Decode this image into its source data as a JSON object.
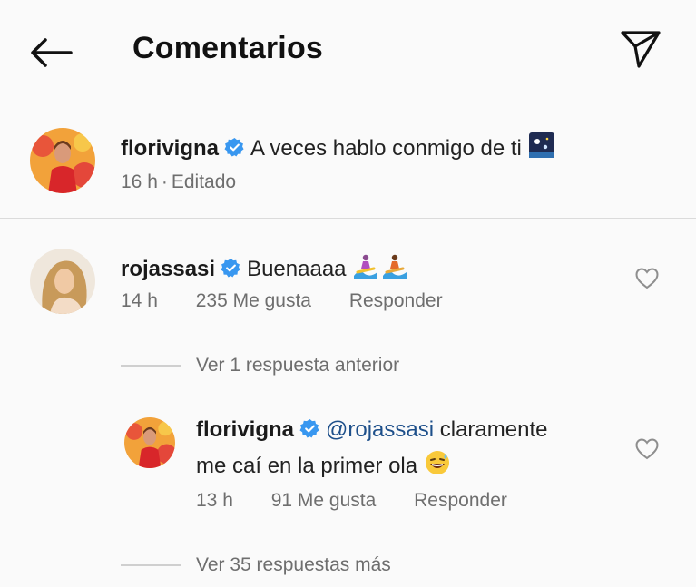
{
  "header": {
    "title": "Comentarios"
  },
  "caption": {
    "username": "florivigna",
    "text": "A veces hablo conmigo de ti",
    "time": "16 h",
    "edited": "Editado"
  },
  "comments": [
    {
      "username": "rojassasi",
      "text": "Buenaaaa",
      "time": "14 h",
      "likes": "235 Me gusta",
      "reply_label": "Responder",
      "view_replies": "Ver 1 respuesta anterior"
    }
  ],
  "reply": {
    "username": "florivigna",
    "mention": "@rojassasi",
    "text_line1": "claramente",
    "text_line2": "me caí en la primer ola",
    "time": "13 h",
    "likes": "91 Me gusta",
    "reply_label": "Responder"
  },
  "more_replies": "Ver 35 respuestas más",
  "icons": {
    "back": "arrow-left-icon",
    "send": "paper-plane-icon",
    "verified": "verified-badge-icon",
    "heart": "heart-outline-icon"
  },
  "colors": {
    "verified": "#3897f0",
    "mention": "#1d4f8a",
    "meta": "#6e6e6e"
  }
}
